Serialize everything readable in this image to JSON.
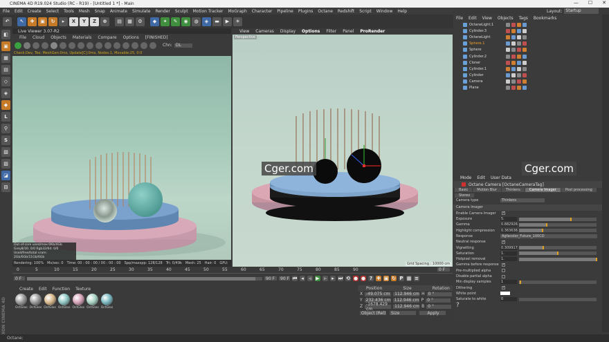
{
  "window": {
    "title": "CINEMA 4D R19.024 Studio (RC - R19) - [Untitled 1 *] - Main",
    "ctrl_min": "—",
    "ctrl_max": "☐",
    "ctrl_close": "✕"
  },
  "menubar": [
    "File",
    "Edit",
    "Create",
    "Select",
    "Tools",
    "Mesh",
    "Snap",
    "Animate",
    "Simulate",
    "Render",
    "Sculpt",
    "Motion Tracker",
    "MoGraph",
    "Character",
    "Pipeline",
    "Plugins",
    "Octane",
    "Redshift",
    "Script",
    "Window",
    "Help"
  ],
  "layout": {
    "label": "Layout:",
    "value": "Startup"
  },
  "live_viewer": {
    "title": "Live Viewer 3.07-R2",
    "menu": [
      "File",
      "Cloud",
      "Objects",
      "Materials",
      "Compare",
      "Options",
      "[FINISHED]"
    ],
    "channel_label": "Chn:",
    "channel_value": "DL",
    "info": "Check:Dev, Tex: MeshGen:0ms, Update[C]:0ms, Nodes:1, Movable:25, 0:0",
    "stats": [
      "Out-of-core used/max:0Kb/4Gb",
      "Grey8/16: 0/0        Rgb32/64: 0/0",
      "Used/free/total vram: 2Gb/6Gb/11Gb/6Gb"
    ],
    "status": [
      "Rendering: 100%",
      "Ms/sec: 0",
      "Time: 00 : 00 : 00 / 00 : 00 : 00",
      "Spp/maxspp: 128/128",
      "Tri: 0/49k",
      "Mesh: 25",
      "Hair: 0",
      "GPU:",
      "65°C"
    ]
  },
  "viewport": {
    "menu": [
      "View",
      "Cameras",
      "Display",
      "Options",
      "Filter",
      "Panel",
      "ProRender"
    ],
    "label": "Perspective",
    "grid": "Grid Spacing : 10000 cm"
  },
  "object_manager": {
    "menu": [
      "File",
      "Edit",
      "View",
      "Objects",
      "Tags",
      "Bookmarks"
    ],
    "objects": [
      {
        "name": "OctaneLight.1",
        "color": "#ddd"
      },
      {
        "name": "Cylinder.3",
        "color": "#ddd"
      },
      {
        "name": "OctaneLight",
        "color": "#ddd"
      },
      {
        "name": "Sphere.1",
        "color": "#f0a030"
      },
      {
        "name": "Sphere",
        "color": "#ddd"
      },
      {
        "name": "Cylinder.2",
        "color": "#ddd"
      },
      {
        "name": "Cloner",
        "color": "#ddd"
      },
      {
        "name": "Cylinder.1",
        "color": "#ddd"
      },
      {
        "name": "Cylinder",
        "color": "#ddd"
      },
      {
        "name": "Camera",
        "color": "#ddd"
      },
      {
        "name": "Plane",
        "color": "#ddd"
      }
    ]
  },
  "attribute_manager": {
    "menu": [
      "Mode",
      "Edit",
      "User Data"
    ],
    "title": "Octane Camera [OctaneCameraTag]",
    "tabs": [
      "Basic",
      "Motion Blur",
      "Thinlens",
      "Camera Imager",
      "Post processing",
      "Stereo"
    ],
    "active_tab": "Camera Imager",
    "camera_type_label": "Camera type",
    "camera_type": "Thinlens",
    "section": "Camera Imager",
    "rows": [
      {
        "label": "Enable Camera Imager",
        "type": "check",
        "value": "✓"
      },
      {
        "label": "Exposure",
        "type": "num",
        "value": "5.",
        "fill": 0.67
      },
      {
        "label": "Gamma",
        "type": "num",
        "value": "0.882926",
        "fill": 0.36
      },
      {
        "label": "Highlight compression",
        "type": "num",
        "value": "0.363636",
        "fill": 0.3
      },
      {
        "label": "Response",
        "type": "select",
        "value": "Agfacolor_Future_100CD"
      },
      {
        "label": "Neutral response",
        "type": "check",
        "value": "✓"
      },
      {
        "label": "Vignetting",
        "type": "num",
        "value": "0.309917",
        "fill": 0.31
      },
      {
        "label": "Saturation",
        "type": "num",
        "value": "1.",
        "fill": 0.5
      },
      {
        "label": "Hotpixel removal",
        "type": "num",
        "value": "1.",
        "fill": 1.0
      },
      {
        "label": "Gamma before response",
        "type": "check",
        "value": "✓"
      },
      {
        "label": "Pre-multiplied alpha",
        "type": "check",
        "value": ""
      },
      {
        "label": "Disable partial alpha",
        "type": "check",
        "value": ""
      },
      {
        "label": "Min display samples",
        "type": "num",
        "value": "1",
        "fill": 0.02
      },
      {
        "label": "Dithering",
        "type": "check",
        "value": "✓"
      },
      {
        "label": "White point",
        "type": "color",
        "value": ""
      },
      {
        "label": "Saturate to white",
        "type": "num",
        "value": "0",
        "fill": 0.0
      }
    ],
    "help": "?"
  },
  "timeline": {
    "ticks": [
      "0",
      "5",
      "10",
      "15",
      "20",
      "25",
      "30",
      "35",
      "40",
      "45",
      "50",
      "55",
      "60",
      "65",
      "70",
      "75",
      "80",
      "85",
      "90"
    ],
    "end": "0 F",
    "start_field": "0 F",
    "current_field": "0 F",
    "end_field": "90 F",
    "max_field": "90 F"
  },
  "material_manager": {
    "menu": [
      "Create",
      "Edit",
      "Function",
      "Texture"
    ],
    "materials": [
      {
        "name": "OctGlas",
        "color": "#999"
      },
      {
        "name": "OctGlos",
        "color": "#9a9a9a"
      },
      {
        "name": "OctGlos",
        "color": "#d7b88a"
      },
      {
        "name": "OctGlos",
        "color": "#8ec7c4"
      },
      {
        "name": "OctGlos",
        "color": "#d6a2b8"
      },
      {
        "name": "OctGlos",
        "color": "#a8d2c2"
      },
      {
        "name": "OctGlos",
        "color": "#7ab8c0"
      }
    ]
  },
  "coordinates": {
    "headers": [
      "Position",
      "Size",
      "Rotation"
    ],
    "rows": [
      {
        "axis": "X",
        "pos": "-49.075 cm",
        "size": "112.946 cm",
        "rlabel": "H",
        "rot": "0 °"
      },
      {
        "axis": "Y",
        "pos": "232.436 cm",
        "size": "112.946 cm",
        "rlabel": "P",
        "rot": "0 °"
      },
      {
        "axis": "Z",
        "pos": "-1678.429 cm",
        "size": "112.946 cm",
        "rlabel": "B",
        "rot": "0 °"
      }
    ],
    "mode1": "Object (Rel)",
    "mode2": "Size",
    "apply": "Apply"
  },
  "watermark": "Cger.com",
  "statusbar": "Octane:"
}
